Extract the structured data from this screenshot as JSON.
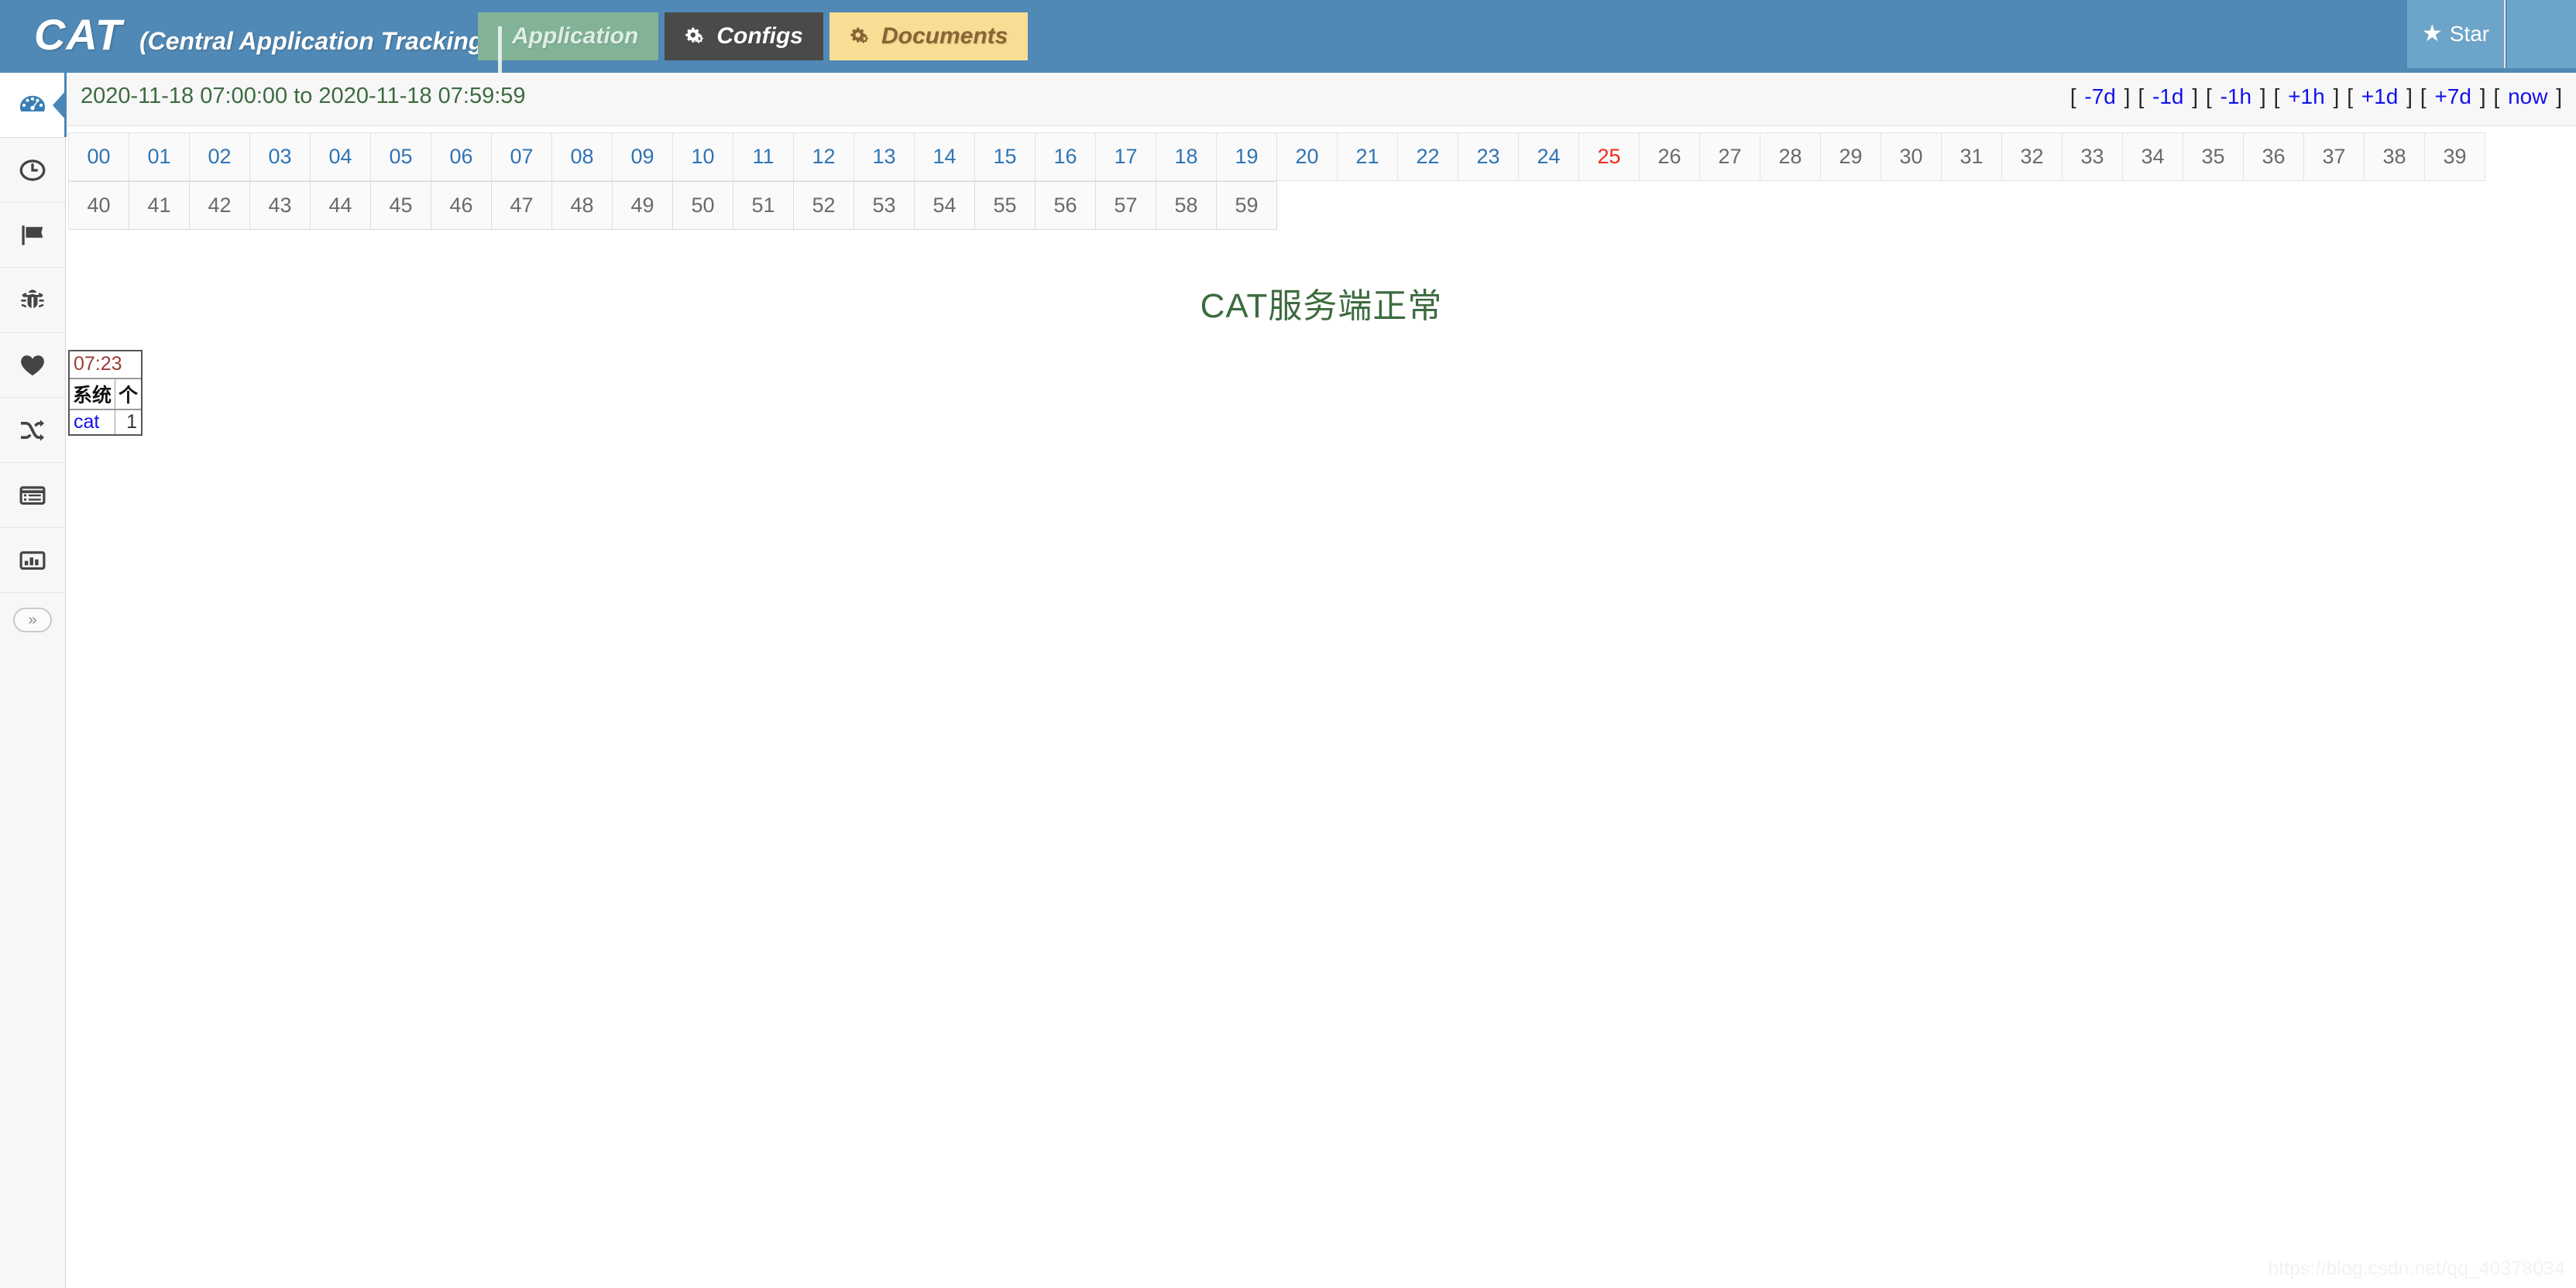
{
  "header": {
    "brand": "CAT",
    "brand_sub": "(Central Application Tracking)",
    "bg_color": "#5089b5",
    "tabs": [
      {
        "label": "Application",
        "icon": "signal-bars-icon",
        "bg": "#82b396",
        "fg": "#dfeee6"
      },
      {
        "label": "Configs",
        "icon": "gears-icon",
        "bg": "#4a4a48",
        "fg": "#ffffff"
      },
      {
        "label": "Documents",
        "icon": "gears-icon",
        "bg": "#f8dd94",
        "fg": "#8a6434"
      }
    ],
    "star": {
      "label": "Star",
      "icon": "star-icon",
      "glyph": "★"
    }
  },
  "sidebar": {
    "items": [
      {
        "name": "dashboard",
        "icon": "gauge-icon",
        "active": true
      },
      {
        "name": "transaction-time",
        "icon": "clock-icon",
        "active": false
      },
      {
        "name": "event",
        "icon": "flag-icon",
        "active": false
      },
      {
        "name": "problem",
        "icon": "bug-icon",
        "active": false
      },
      {
        "name": "heartbeat",
        "icon": "heart-icon",
        "active": false
      },
      {
        "name": "cross-report",
        "icon": "shuffle-icon",
        "active": false
      },
      {
        "name": "logview",
        "icon": "list-icon",
        "active": false
      },
      {
        "name": "report",
        "icon": "bar-chart-icon",
        "active": false
      }
    ],
    "expand": {
      "name": "expand-sidebar",
      "icon": "chevron-double-right-icon",
      "glyph": "»"
    }
  },
  "main": {
    "date_range": "2020-11-18 07:00:00 to 2020-11-18 07:59:59",
    "date_range_color": "#3d6b3f",
    "time_nav": [
      {
        "label": "-7d"
      },
      {
        "label": "-1d"
      },
      {
        "label": "-1h"
      },
      {
        "label": "+1h"
      },
      {
        "label": "+1d"
      },
      {
        "label": "+7d"
      },
      {
        "label": "now"
      }
    ],
    "bracket_open": "[",
    "bracket_close": "]",
    "minute_grid": {
      "row1": [
        {
          "label": "00",
          "state": "link"
        },
        {
          "label": "01",
          "state": "link"
        },
        {
          "label": "02",
          "state": "link"
        },
        {
          "label": "03",
          "state": "link"
        },
        {
          "label": "04",
          "state": "link"
        },
        {
          "label": "05",
          "state": "link"
        },
        {
          "label": "06",
          "state": "link"
        },
        {
          "label": "07",
          "state": "link"
        },
        {
          "label": "08",
          "state": "link"
        },
        {
          "label": "09",
          "state": "link"
        },
        {
          "label": "10",
          "state": "link"
        },
        {
          "label": "11",
          "state": "link"
        },
        {
          "label": "12",
          "state": "link"
        },
        {
          "label": "13",
          "state": "link"
        },
        {
          "label": "14",
          "state": "link"
        },
        {
          "label": "15",
          "state": "link"
        },
        {
          "label": "16",
          "state": "link"
        },
        {
          "label": "17",
          "state": "link"
        },
        {
          "label": "18",
          "state": "link"
        },
        {
          "label": "19",
          "state": "link"
        },
        {
          "label": "20",
          "state": "link"
        },
        {
          "label": "21",
          "state": "link"
        },
        {
          "label": "22",
          "state": "link"
        },
        {
          "label": "23",
          "state": "link"
        },
        {
          "label": "24",
          "state": "link"
        },
        {
          "label": "25",
          "state": "current"
        },
        {
          "label": "26",
          "state": "muted"
        },
        {
          "label": "27",
          "state": "muted"
        },
        {
          "label": "28",
          "state": "muted"
        },
        {
          "label": "29",
          "state": "muted"
        },
        {
          "label": "30",
          "state": "muted"
        },
        {
          "label": "31",
          "state": "muted"
        },
        {
          "label": "32",
          "state": "muted"
        },
        {
          "label": "33",
          "state": "muted"
        },
        {
          "label": "34",
          "state": "muted"
        },
        {
          "label": "35",
          "state": "muted"
        },
        {
          "label": "36",
          "state": "muted"
        },
        {
          "label": "37",
          "state": "muted"
        },
        {
          "label": "38",
          "state": "muted"
        },
        {
          "label": "39",
          "state": "muted"
        }
      ],
      "row2": [
        {
          "label": "40",
          "state": "muted"
        },
        {
          "label": "41",
          "state": "muted"
        },
        {
          "label": "42",
          "state": "muted"
        },
        {
          "label": "43",
          "state": "muted"
        },
        {
          "label": "44",
          "state": "muted"
        },
        {
          "label": "45",
          "state": "muted"
        },
        {
          "label": "46",
          "state": "muted"
        },
        {
          "label": "47",
          "state": "muted"
        },
        {
          "label": "48",
          "state": "muted"
        },
        {
          "label": "49",
          "state": "muted"
        },
        {
          "label": "50",
          "state": "muted"
        },
        {
          "label": "51",
          "state": "muted"
        },
        {
          "label": "52",
          "state": "muted"
        },
        {
          "label": "53",
          "state": "muted"
        },
        {
          "label": "54",
          "state": "muted"
        },
        {
          "label": "55",
          "state": "muted"
        },
        {
          "label": "56",
          "state": "muted"
        },
        {
          "label": "57",
          "state": "muted"
        },
        {
          "label": "58",
          "state": "muted"
        },
        {
          "label": "59",
          "state": "muted"
        }
      ],
      "colors": {
        "link": "#2f74b5",
        "current": "#ef2b1f",
        "muted": "#6a6a6a"
      }
    },
    "status_text": "CAT服务端正常",
    "status_color": "#3d6b3f",
    "tooltip": {
      "time": "07:23",
      "headers": [
        "系统",
        "个"
      ],
      "rows": [
        {
          "key": "cat",
          "value": "1"
        }
      ]
    }
  },
  "watermark": "https://blog.csdn.net/qq_40378034"
}
